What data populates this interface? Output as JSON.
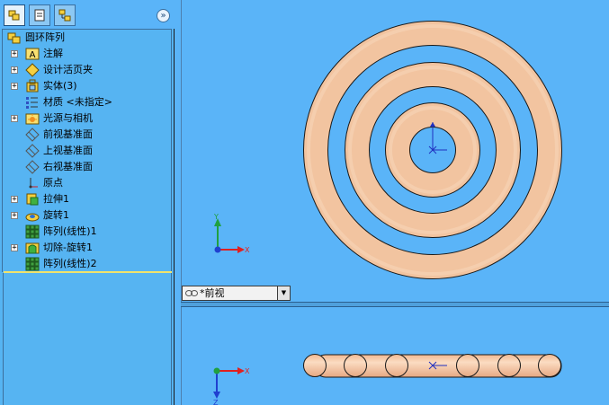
{
  "feature_tree": {
    "root": {
      "label": "圆环阵列",
      "icon": "part-icon"
    },
    "items": [
      {
        "label": "注解",
        "icon": "annotation-icon",
        "expandable": true
      },
      {
        "label": "设计活页夹",
        "icon": "design-binder-icon",
        "expandable": true
      },
      {
        "label": "实体(3)",
        "icon": "solid-bodies-icon",
        "expandable": true
      },
      {
        "label": "材质 <未指定>",
        "icon": "material-icon",
        "expandable": false
      },
      {
        "label": "光源与相机",
        "icon": "lights-cameras-icon",
        "expandable": true
      },
      {
        "label": "前视基准面",
        "icon": "plane-icon",
        "expandable": false
      },
      {
        "label": "上视基准面",
        "icon": "plane-icon",
        "expandable": false
      },
      {
        "label": "右视基准面",
        "icon": "plane-icon",
        "expandable": false
      },
      {
        "label": "原点",
        "icon": "origin-icon",
        "expandable": false
      },
      {
        "label": "拉伸1",
        "icon": "extrude-icon",
        "expandable": true
      },
      {
        "label": "旋转1",
        "icon": "revolve-icon",
        "expandable": true
      },
      {
        "label": "阵列(线性)1",
        "icon": "linear-pattern-icon",
        "expandable": false
      },
      {
        "label": "切除-旋转1",
        "icon": "cut-revolve-icon",
        "expandable": true
      },
      {
        "label": "阵列(线性)2",
        "icon": "linear-pattern-icon",
        "expandable": false
      }
    ]
  },
  "tabs": [
    {
      "name": "feature-manager-tab",
      "active": true
    },
    {
      "name": "property-manager-tab",
      "active": false
    },
    {
      "name": "configuration-manager-tab",
      "active": false
    }
  ],
  "viewport_top": {
    "view_name": "*前视"
  },
  "triad_top": {
    "x_label": "X",
    "y_label": "Y"
  },
  "triad_bottom": {
    "x_label": "X",
    "z_label": "Z"
  },
  "colors": {
    "background": "#5ab4f8",
    "ring_fill": "#f2c4a0",
    "ring_edge": "#1a1a1a",
    "axis_x": "#e02020",
    "axis_y": "#20a040",
    "axis_z": "#2040d0"
  }
}
